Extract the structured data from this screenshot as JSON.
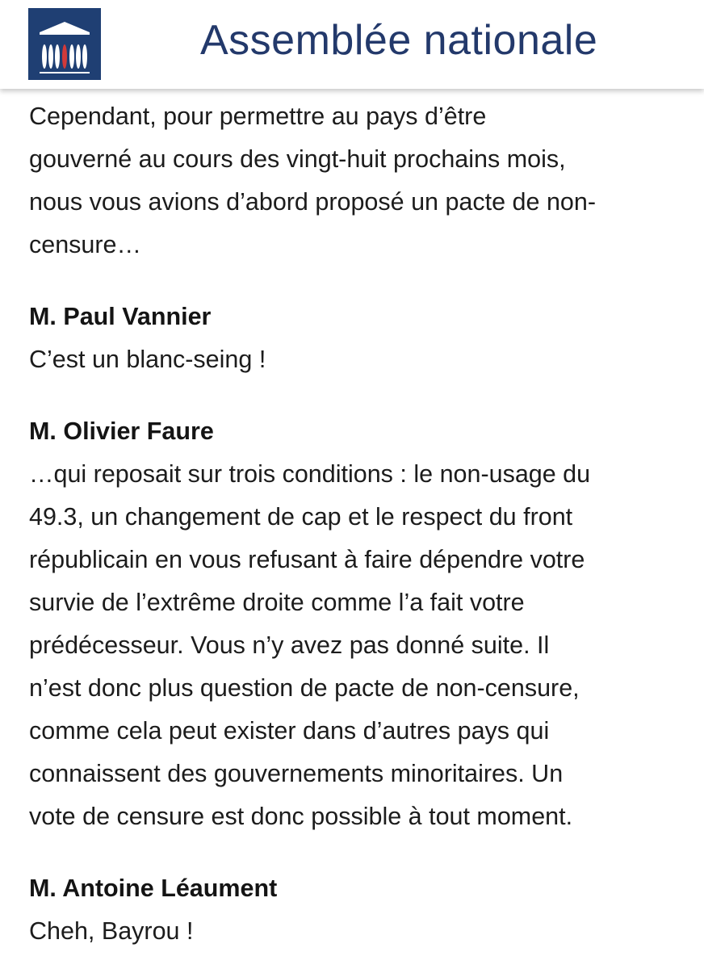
{
  "header": {
    "site_title": "Assemblée nationale",
    "logo_icon": "assemblee-nationale-logo",
    "logo_color": "#1f3f73",
    "title_color": "#23396b"
  },
  "transcript": {
    "intro_lines": [
      "Cependant, pour permettre au pays d’être",
      "gouverné au cours des vingt-huit prochains mois,",
      "nous vous avions d’abord proposé un pacte de non-",
      "censure…"
    ],
    "interventions": [
      {
        "speaker": "M. Paul Vannier",
        "lines": [
          "C’est un blanc-seing !"
        ]
      },
      {
        "speaker": "M. Olivier Faure",
        "lines": [
          "…qui reposait sur trois conditions : le non-usage du",
          "49.3, un changement de cap et le respect du front",
          "républicain en vous refusant à faire dépendre votre",
          "survie de l’extrême droite comme l’a fait votre",
          "prédécesseur. Vous n’y avez pas donné suite. Il",
          "n’est donc plus question de pacte de non-censure,",
          "comme cela peut exister dans d’autres pays qui",
          "connaissent des gouvernements minoritaires. Un",
          "vote de censure est donc possible à tout moment."
        ]
      },
      {
        "speaker": "M. Antoine Léaument",
        "lines": [
          "Cheh, Bayrou !"
        ]
      }
    ]
  }
}
